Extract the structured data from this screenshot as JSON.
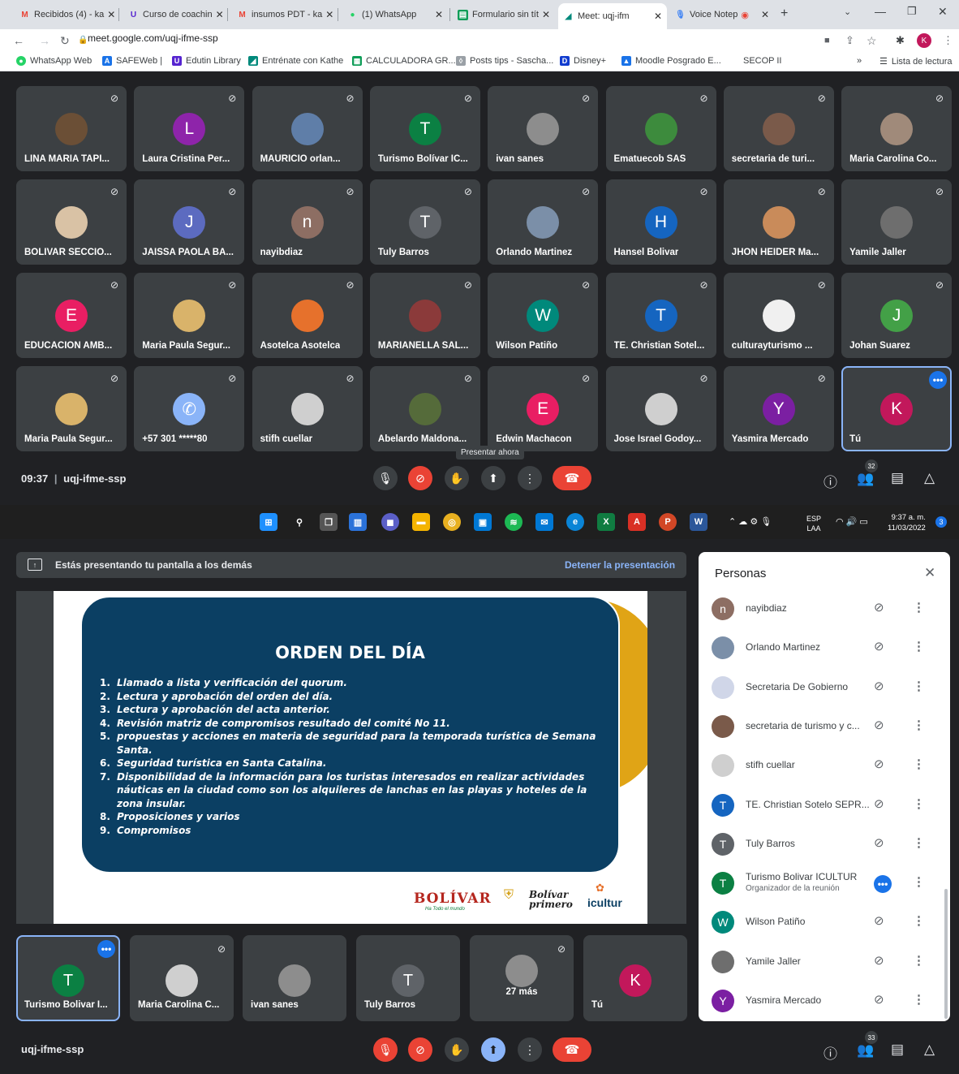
{
  "browser": {
    "tabs": [
      {
        "title": "Recibidos (4) - ka",
        "icon": "gmail-icon",
        "color": "#ea4335"
      },
      {
        "title": "Curso de coachin",
        "icon": "udemy-icon",
        "color": "#5624d0"
      },
      {
        "title": "insumos PDT - ka",
        "icon": "gmail-icon",
        "color": "#ea4335"
      },
      {
        "title": "(1) WhatsApp",
        "icon": "whatsapp-icon",
        "color": "#25d366"
      },
      {
        "title": "Formulario sin tít",
        "icon": "forms-icon",
        "color": "#0f9d58"
      },
      {
        "title": "Meet: uqj-ifm",
        "icon": "meet-icon",
        "color": "#00897b"
      },
      {
        "title": "Voice Notep",
        "icon": "mic-icon",
        "color": "#4285f4"
      }
    ],
    "url": "meet.google.com/uqj-ifme-ssp",
    "profile_initial": "K",
    "bookmarks": [
      "WhatsApp Web",
      "SAFEWeb |",
      "Edutin Library",
      "Entrénate con Kathe",
      "CALCULADORA GR...",
      "Posts tips - Sascha...",
      "Disney+",
      "Moodle Posgrado E...",
      "SECOP II"
    ],
    "reading_list": "Lista de lectura",
    "more_bookmarks": "»"
  },
  "meet_top": {
    "participants": [
      {
        "name": "LINA MARIA TAPI...",
        "initial": "",
        "color": "#6b4f36"
      },
      {
        "name": "Laura Cristina Per...",
        "initial": "L",
        "color": "#8e24aa"
      },
      {
        "name": "MAURICIO orlan...",
        "initial": "",
        "color": "#5f7ea8"
      },
      {
        "name": "Turismo Bolívar IC...",
        "initial": "T",
        "color": "#0b8043"
      },
      {
        "name": "ivan sanes",
        "initial": "",
        "color": "#8d8d8d"
      },
      {
        "name": "Ematuecob SAS",
        "initial": "",
        "color": "#3d8b3d"
      },
      {
        "name": "secretaria de turi...",
        "initial": "",
        "color": "#7a5a4a"
      },
      {
        "name": "Maria Carolina Co...",
        "initial": "",
        "color": "#a08a7a"
      },
      {
        "name": "BOLIVAR SECCIO...",
        "initial": "",
        "color": "#d9c2a5"
      },
      {
        "name": "JAISSA PAOLA BA...",
        "initial": "J",
        "color": "#5c6bc0"
      },
      {
        "name": "nayibdiaz",
        "initial": "n",
        "color": "#8d6e63"
      },
      {
        "name": "Tuly Barros",
        "initial": "T",
        "color": "#5f6368"
      },
      {
        "name": "Orlando Martinez",
        "initial": "",
        "color": "#7b8fa8"
      },
      {
        "name": "Hansel Bolivar",
        "initial": "H",
        "color": "#1565c0"
      },
      {
        "name": "JHON HEIDER Ma...",
        "initial": "",
        "color": "#c98b5a"
      },
      {
        "name": "Yamile Jaller",
        "initial": "",
        "color": "#6e6e6e"
      },
      {
        "name": "EDUCACIÓN AMB...",
        "initial": "E",
        "color": "#e91e63"
      },
      {
        "name": "Maria Paula Segur...",
        "initial": "",
        "color": "#d9b36a"
      },
      {
        "name": "Asotelca Asotelca",
        "initial": "",
        "color": "#e6712c"
      },
      {
        "name": "MARIANELLA SAL...",
        "initial": "",
        "color": "#8b3a3a"
      },
      {
        "name": "Wilson Patiño",
        "initial": "W",
        "color": "#00897b"
      },
      {
        "name": "TE. Christian Sotel...",
        "initial": "T",
        "color": "#1565c0"
      },
      {
        "name": "culturayturismo ...",
        "initial": "",
        "color": "#f0f0f0"
      },
      {
        "name": "Johan Suarez",
        "initial": "J",
        "color": "#43a047"
      },
      {
        "name": "Maria Paula Segur...",
        "initial": "",
        "color": "#d9b36a"
      },
      {
        "name": "+57 301 *****80",
        "initial": "✆",
        "color": "#8ab4f8"
      },
      {
        "name": "stifh cuellar",
        "initial": "",
        "color": "#cfcfcf"
      },
      {
        "name": "Abelardo Maldona...",
        "initial": "",
        "color": "#556b3a"
      },
      {
        "name": "Edwin Machacon",
        "initial": "E",
        "color": "#e91e63"
      },
      {
        "name": "Jose Israel Godoy...",
        "initial": "",
        "color": "#cfcfcf"
      },
      {
        "name": "Yasmira Mercado",
        "initial": "Y",
        "color": "#7b1fa2"
      },
      {
        "name": "Tú",
        "initial": "K",
        "color": "#c2185b"
      }
    ],
    "time": "09:37",
    "separator": "|",
    "meeting_code": "uqj-ifme-ssp",
    "tooltip": "Presentar ahora",
    "people_count": "32"
  },
  "taskbar": {
    "lang": "ESP",
    "lang2": "LAA",
    "time": "9:37 a. m.",
    "date": "11/03/2022",
    "notifications": "3"
  },
  "presentation": {
    "banner": "Estás presentando tu pantalla a los demás",
    "stop": "Detener la presentación",
    "slide_title": "ORDEN DEL DÍA",
    "items": [
      {
        "n": "1.",
        "t": "Llamado a lista y verificación del quorum."
      },
      {
        "n": "2.",
        "t": "Lectura y aprobación del orden del día."
      },
      {
        "n": "3.",
        "t": "Lectura y aprobación del acta anterior."
      },
      {
        "n": "4.",
        "t": "Revisión matriz de compromisos resultado del comité No 11."
      },
      {
        "n": "5.",
        "t": "propuestas y acciones en materia de seguridad para la temporada turística de Semana Santa."
      },
      {
        "n": "6.",
        "t": "Seguridad turística en Santa Catalina."
      },
      {
        "n": "7.",
        "t": "Disponibilidad de la información para los turistas interesados en realizar actividades náuticas en la ciudad como son los alquileres de lanchas en las playas y hoteles de la zona insular."
      },
      {
        "n": "8.",
        "t": "Proposiciones y varios"
      },
      {
        "n": "9.",
        "t": "Compromisos"
      }
    ],
    "logo_bolivar": "BOLÍVAR",
    "logo_bolivar_sub": "Ha Todo el mundo",
    "logo_primero": "Bolívar primero",
    "logo_icultur": "icultur"
  },
  "people_panel": {
    "title": "Personas",
    "people": [
      {
        "name": "nayibdiaz",
        "initial": "n",
        "color": "#8d6e63",
        "role": ""
      },
      {
        "name": "Orlando Martinez",
        "initial": "",
        "color": "#7b8fa8",
        "role": ""
      },
      {
        "name": "Secretaria De Gobierno",
        "initial": "",
        "color": "#d0d6e8",
        "role": ""
      },
      {
        "name": "secretaria de turismo y c...",
        "initial": "",
        "color": "#7a5a4a",
        "role": ""
      },
      {
        "name": "stifh cuellar",
        "initial": "",
        "color": "#cfcfcf",
        "role": ""
      },
      {
        "name": "TE. Christian Sotelo SEPR...",
        "initial": "T",
        "color": "#1565c0",
        "role": ""
      },
      {
        "name": "Tuly Barros",
        "initial": "T",
        "color": "#5f6368",
        "role": ""
      },
      {
        "name": "Turismo Bolivar ICULTUR",
        "initial": "T",
        "color": "#0b8043",
        "role": "Organizador de la reunión"
      },
      {
        "name": "Wilson Patiño",
        "initial": "W",
        "color": "#00897b",
        "role": ""
      },
      {
        "name": "Yamile Jaller",
        "initial": "",
        "color": "#6e6e6e",
        "role": ""
      },
      {
        "name": "Yasmira Mercado",
        "initial": "Y",
        "color": "#7b1fa2",
        "role": ""
      }
    ]
  },
  "meet_bottom": {
    "tiles": [
      {
        "name": "Turismo Bolivar I...",
        "initial": "T",
        "color": "#0b8043"
      },
      {
        "name": "Maria Carolina C...",
        "initial": "",
        "color": "#cfcfcf"
      },
      {
        "name": "ivan sanes",
        "initial": "",
        "color": "#8d8d8d"
      },
      {
        "name": "Tuly Barros",
        "initial": "T",
        "color": "#5f6368"
      },
      {
        "name": "27 más",
        "initial": "",
        "color": "#8d8d8d"
      },
      {
        "name": "Tú",
        "initial": "K",
        "color": "#c2185b"
      }
    ],
    "meeting_code": "uqj-ifme-ssp",
    "people_count": "33"
  }
}
